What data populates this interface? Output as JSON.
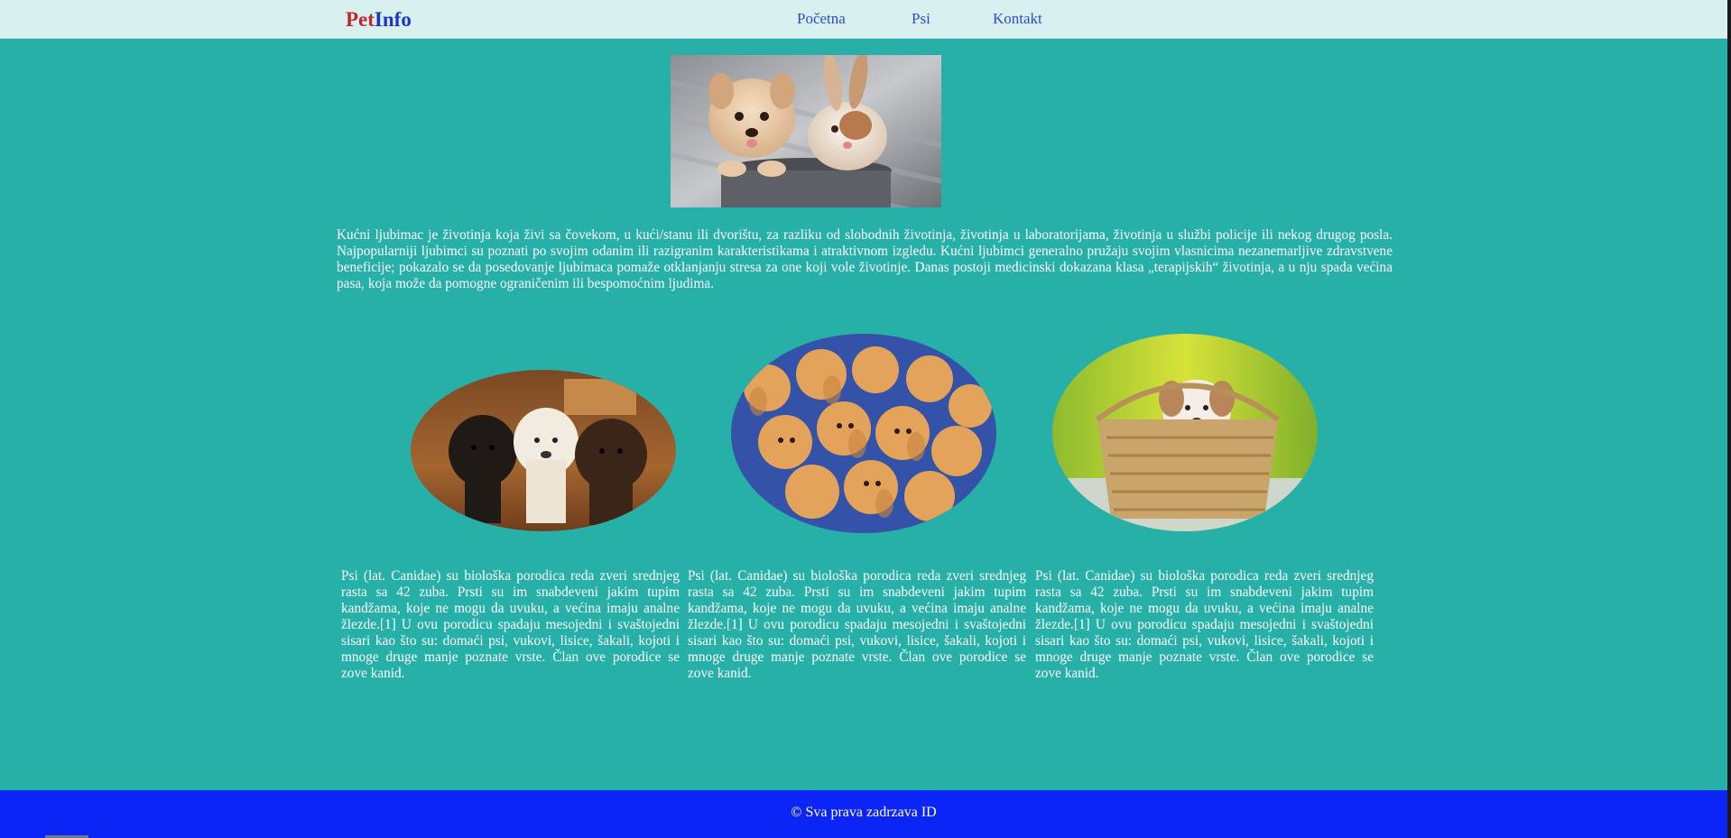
{
  "brand": {
    "pet": "Pet",
    "info": "Info",
    "pet_color": "#c4262e",
    "info_color": "#1f33c9"
  },
  "nav": {
    "items": [
      "Početna",
      "Psi",
      "Kontakt"
    ]
  },
  "hero": {
    "image": "puppy-and-bunny-photo"
  },
  "intro": {
    "text": "Kućni ljubimac je životinja koja živi sa čovekom, u kući/stanu ili dvorištu, za razliku od slobodnih životinja, životinja u laboratorijama, životinja u službi policije ili nekog drugog posla. Najpopularniji ljubimci su poznati po svojim odanim ili razigranim karakteristikama i atraktivnom izgledu. Kućni ljubimci generalno pružaju svojim vlasnicima nezanemarljive zdravstvene beneficije; pokazalo se da posedovanje ljubimaca pomaže otklanjanju stresa za one koji vole životinje. Danas postoji medicinski dokazana klasa „terapijskih“ životinja, a u nju spada većina pasa, koja može da pomogne ograničenim ili bespomoćnim ljudima."
  },
  "cards": [
    {
      "image": "labrador-puppies-photo",
      "text": "Psi (lat. Canidae) su biološka porodica reda zveri srednjeg rasta sa 42 zuba. Prsti su im snabdeveni jakim tupim kandžama, koje ne mogu da uvuku, a većina imaju analne žlezde.[1] U ovu porodicu spadaju mesojedni i svaštojedni sisari kao što su: domaći psi, vukovi, lisice, šakali, kojoti i mnoge druge manje poznate vrste. Član ove porodice se zove kanid."
    },
    {
      "image": "golden-retriever-puppies-photo",
      "text": "Psi (lat. Canidae) su biološka porodica reda zveri srednjeg rasta sa 42 zuba. Prsti su im snabdeveni jakim tupim kandžama, koje ne mogu da uvuku, a većina imaju analne žlezde.[1] U ovu porodicu spadaju mesojedni i svaštojedni sisari kao što su: domaći psi, vukovi, lisice, šakali, kojoti i mnoge druge manje poznate vrste. Član ove porodice se zove kanid."
    },
    {
      "image": "puppy-in-basket-photo",
      "text": "Psi (lat. Canidae) su biološka porodica reda zveri srednjeg rasta sa 42 zuba. Prsti su im snabdeveni jakim tupim kandžama, koje ne mogu da uvuku, a većina imaju analne žlezde.[1] U ovu porodicu spadaju mesojedni i svaštojedni sisari kao što su: domaći psi, vukovi, lisice, šakali, kojoti i mnoge druge manje poznate vrste. Član ove porodice se zove kanid."
    }
  ],
  "footer": {
    "text": "© Sva prava zadrzava ID",
    "color": "#0a25f5"
  },
  "colors": {
    "page_bg": "#27b0a8",
    "nav_bg": "#d8f0f0",
    "link": "#2d4bd6"
  }
}
